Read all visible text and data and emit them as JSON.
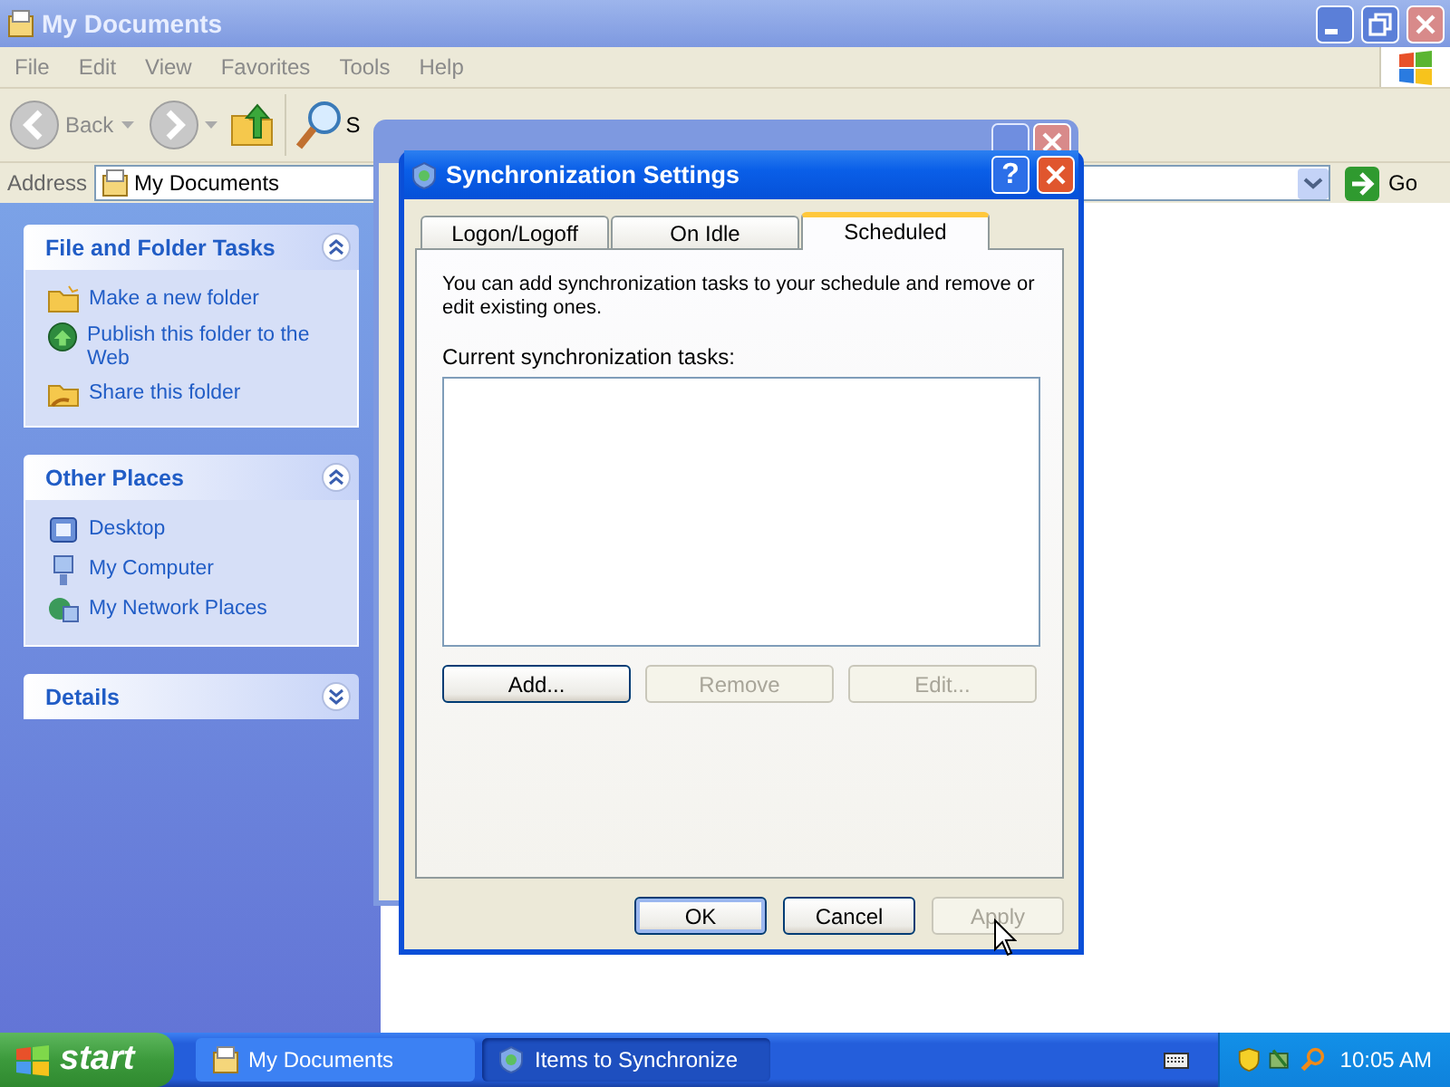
{
  "explorer": {
    "title": "My Documents",
    "menu": [
      "File",
      "Edit",
      "View",
      "Favorites",
      "Tools",
      "Help"
    ],
    "toolbar": {
      "back": "Back",
      "search": "S"
    },
    "address": {
      "label": "Address",
      "value": "My Documents",
      "go": "Go"
    },
    "panels": [
      {
        "title": "File and Folder Tasks",
        "expanded": true,
        "items": [
          {
            "kind": "folder",
            "label": "Make a new folder"
          },
          {
            "kind": "globe",
            "label": "Publish this folder to the Web"
          },
          {
            "kind": "share",
            "label": "Share this folder"
          }
        ]
      },
      {
        "title": "Other Places",
        "expanded": true,
        "items": [
          {
            "kind": "desktop",
            "label": "Desktop"
          },
          {
            "kind": "computer",
            "label": "My Computer"
          },
          {
            "kind": "network",
            "label": "My Network Places"
          }
        ]
      },
      {
        "title": "Details",
        "expanded": false
      }
    ]
  },
  "dialog": {
    "title": "Synchronization Settings",
    "help": "?",
    "tabs": [
      {
        "label": "Logon/Logoff",
        "selected": false
      },
      {
        "label": "On Idle",
        "selected": false
      },
      {
        "label": "Scheduled",
        "selected": true
      }
    ],
    "description": "You can add synchronization tasks to your schedule and remove or edit existing ones.",
    "list_label": "Current synchronization tasks:",
    "actions": [
      {
        "label": "Add...",
        "disabled": false
      },
      {
        "label": "Remove",
        "disabled": true
      },
      {
        "label": "Edit...",
        "disabled": true
      }
    ],
    "buttons": [
      {
        "label": "OK",
        "default": true,
        "disabled": false
      },
      {
        "label": "Cancel",
        "default": false,
        "disabled": false
      },
      {
        "label": "Apply",
        "default": false,
        "disabled": true
      }
    ]
  },
  "taskbar": {
    "start": "start",
    "tasks": [
      {
        "label": "My Documents",
        "kind": "documents",
        "selected": false
      },
      {
        "label": "Items to Synchronize",
        "kind": "sync",
        "selected": true
      }
    ],
    "clock": "10:05 AM"
  }
}
